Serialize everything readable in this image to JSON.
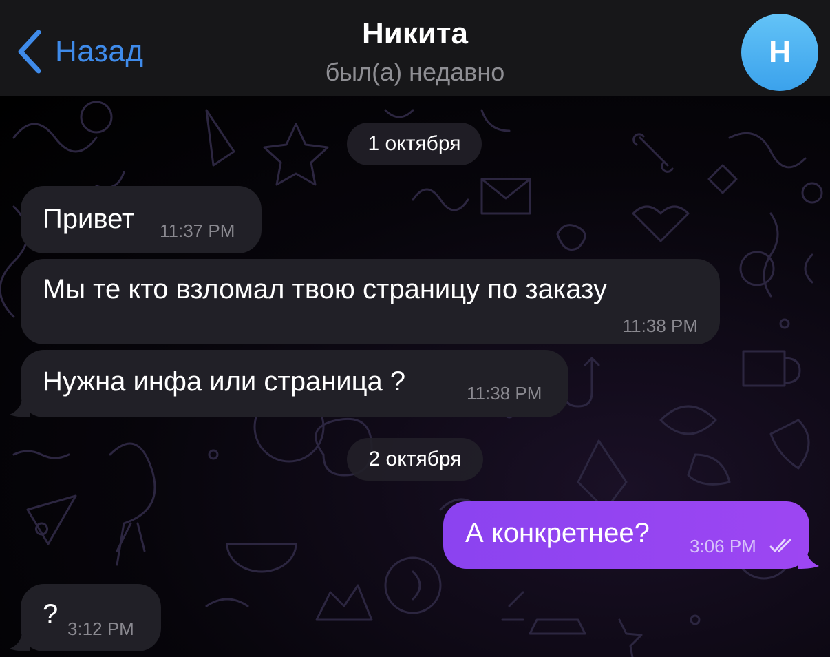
{
  "header": {
    "back_label": "Назад",
    "title": "Никита",
    "subtitle": "был(а) недавно",
    "avatar_letter": "Н"
  },
  "dates": [
    {
      "label": "1 октября"
    },
    {
      "label": "2 октября"
    }
  ],
  "messages": [
    {
      "direction": "incoming",
      "text": "Привет",
      "time": "11:37 PM"
    },
    {
      "direction": "incoming",
      "text": "Мы те кто взломал твою страницу по заказу",
      "time": "11:38 PM"
    },
    {
      "direction": "incoming",
      "text": "Нужна инфа или страница ?",
      "time": "11:38 PM"
    },
    {
      "direction": "outgoing",
      "text": "А конкретнее?",
      "time": "3:06 PM",
      "status": "read"
    },
    {
      "direction": "incoming",
      "text": "?",
      "time": "3:12 PM"
    }
  ],
  "colors": {
    "accent": "#3f8bea",
    "incoming_bubble": "#212027",
    "outgoing_bubble": "#9443f1",
    "header_bg": "#171719",
    "avatar": "#4ab0f0"
  },
  "icons": {
    "back": "chevron-left-icon",
    "read_status": "double-check-icon"
  }
}
